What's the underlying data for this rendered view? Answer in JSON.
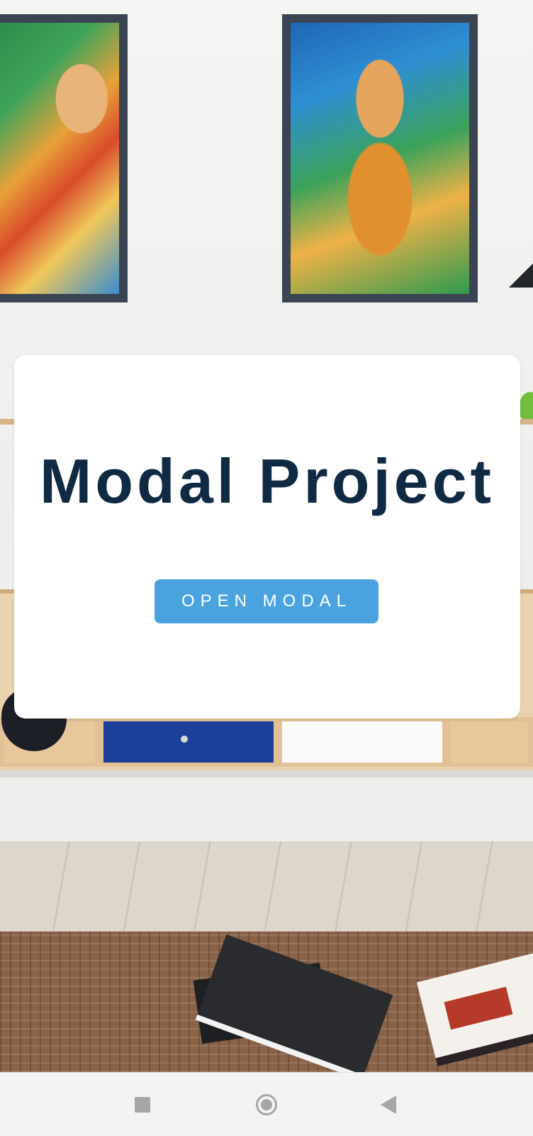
{
  "app": {
    "title": "Modal Project"
  },
  "modal_card": {
    "title": "Modal Project",
    "open_button_label": "OPEN MODAL"
  },
  "background": {
    "description_icon": "room-interior-image"
  },
  "nav_bar": {
    "recents_icon": "square-icon",
    "home_icon": "circle-home-icon",
    "back_icon": "triangle-back-icon"
  },
  "colors": {
    "title_text": "#102a43",
    "button_bg": "#4aa3df",
    "button_text": "#ffffff",
    "card_bg": "#ffffff",
    "nav_bg": "#f3f3f3"
  }
}
